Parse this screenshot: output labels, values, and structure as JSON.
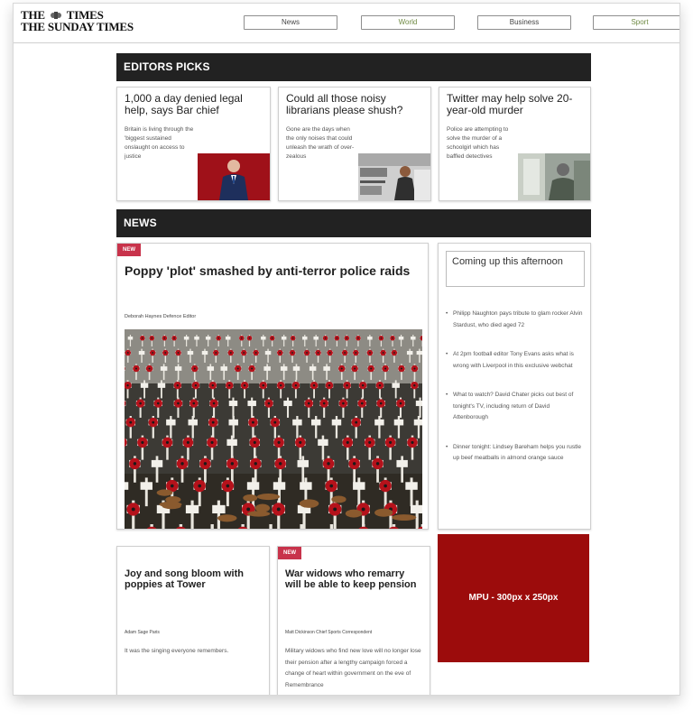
{
  "masthead": {
    "line1_left": "THE",
    "line1_right": "TIMES",
    "line2": "THE SUNDAY TIMES"
  },
  "nav": {
    "items": [
      "News",
      "World",
      "Business",
      "Sport"
    ]
  },
  "editors_picks": {
    "heading": "EDITORS PICKS",
    "items": [
      {
        "title": "1,000 a day denied legal help, says Bar chief",
        "body": "Britain is living through the 'biggest sustained onslaught on access to justice"
      },
      {
        "title": "Could all those noisy librarians please shush?",
        "body": "Gone are the days when the only noises that could unleash the wrath of over-zealous"
      },
      {
        "title": "Twitter may help solve 20-year-old murder",
        "body": "Police are attempting to solve the murder of a schoolgirl which has baffled detectives"
      }
    ]
  },
  "news": {
    "heading": "NEWS",
    "badge": "NEW",
    "main": {
      "headline": "Poppy 'plot' smashed by anti-terror police raids",
      "byline": "Deborah Haynes Defence Editor"
    },
    "sidebar": {
      "title": "Coming up this afternoon",
      "items": [
        "Philipp Naughton pays tribute to glam rocker Alvin Stardust, who died aged 72",
        "At 2pm football editor Tony Evans asks what is wrong with Liverpool in this exclusive webchat",
        "What to watch? David Chater picks out best of tonight's TV, including return of David Attenborough",
        "Dinner tonight: Lindsey Bareham helps you rustle up beef meatballs in almond orange sauce"
      ]
    },
    "story2": {
      "headline": "Joy and song bloom with poppies at Tower",
      "byline": "Adam Sage Paris",
      "body": "It was the singing everyone remembers."
    },
    "story3": {
      "headline": "War widows who remarry will be able to keep pension",
      "byline": "Matt Dickinson Chief Sports Correspondent",
      "body": "Military widows who find new love will no longer lose their pension after a lengthy campaign forced a change of heart within government on the eve of Remembrance"
    },
    "mpu": "MPU - 300px x 250px"
  },
  "colors": {
    "section_bar": "#222222",
    "new_badge": "#c8334b",
    "mpu": "#9c0c0c"
  }
}
